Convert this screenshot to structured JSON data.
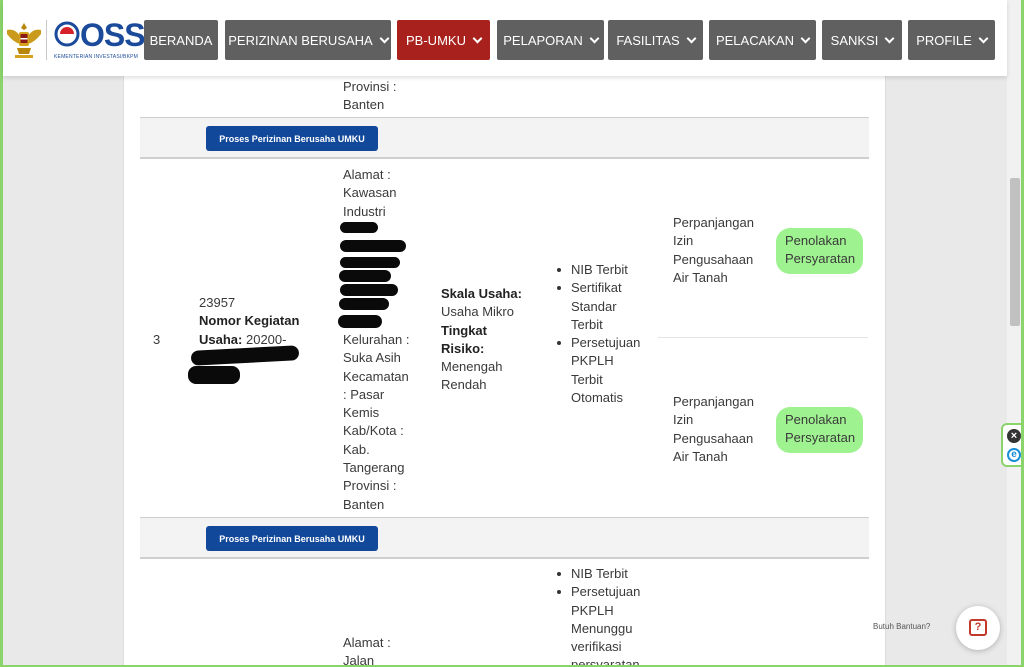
{
  "header": {
    "logo_text": "OSS",
    "logo_subtitle": "KEMENTERIAN INVESTASI/BKPM",
    "nav": [
      {
        "label": "BERANDA",
        "dropdown": false
      },
      {
        "label": "PERIZINAN BERUSAHA",
        "dropdown": true
      },
      {
        "label": "PB-UMKU",
        "dropdown": true,
        "active": true
      },
      {
        "label": "PELAPORAN",
        "dropdown": true
      },
      {
        "label": "FASILITAS",
        "dropdown": true
      },
      {
        "label": "PELACAKAN",
        "dropdown": true
      },
      {
        "label": "SANKSI",
        "dropdown": true
      },
      {
        "label": "PROFILE",
        "dropdown": true
      }
    ]
  },
  "colors": {
    "nav_bg": "#606060",
    "nav_active": "#a8211c",
    "button_blue": "#12489a",
    "highlight": "#9ff290"
  },
  "top_partial": {
    "provinsi_label": "Provinsi :",
    "provinsi_value": "Banten"
  },
  "process_button_label": "Proses Perizinan Berusaha UMKU",
  "row3": {
    "number": "3",
    "kbli_code": "23957",
    "nomor_kegiatan_label": "Nomor Kegiatan Usaha:",
    "nomor_kegiatan_value": "20200-",
    "alamat_label": "Alamat :",
    "alamat_lines": [
      "Kawasan",
      "Industri"
    ],
    "kelurahan_lines": [
      "Kelurahan :",
      "Suka Asih"
    ],
    "kecamatan_lines": [
      "Kecamatan",
      ": Pasar",
      "Kemis"
    ],
    "kabkota_lines": [
      "Kab/Kota :",
      "Kab.",
      "Tangerang"
    ],
    "provinsi_lines": [
      "Provinsi :",
      "Banten"
    ],
    "skala_label": "Skala Usaha:",
    "skala_value": "Usaha Mikro",
    "risiko_label1": "Tingkat",
    "risiko_label2": "Risiko:",
    "risiko_value1": "Menengah",
    "risiko_value2": "Rendah",
    "status_items": [
      [
        "NIB Terbit"
      ],
      [
        "Sertifikat",
        "Standar",
        "Terbit"
      ],
      [
        "Persetujuan",
        "PKPLH",
        "Terbit",
        "Otomatis"
      ]
    ],
    "izin_rows": [
      {
        "name_lines": [
          "Perpanjangan",
          "Izin",
          "Pengusahaan",
          "Air Tanah"
        ],
        "status_lines": [
          "Penolakan",
          "Persyaratan"
        ]
      },
      {
        "name_lines": [
          "Perpanjangan",
          "Izin",
          "Pengusahaan",
          "Air Tanah"
        ],
        "status_lines": [
          "Penolakan",
          "Persyaratan"
        ]
      }
    ]
  },
  "row4_partial": {
    "status_items": [
      [
        "NIB Terbit"
      ],
      [
        "Persetujuan",
        "PKPLH",
        "Menunggu",
        "verifikasi",
        "persyaratan"
      ]
    ],
    "alamat_label": "Alamat :",
    "alamat_first": "Jalan"
  },
  "help": {
    "label": "Butuh Bantuan?",
    "icon": "question-chat-icon"
  }
}
